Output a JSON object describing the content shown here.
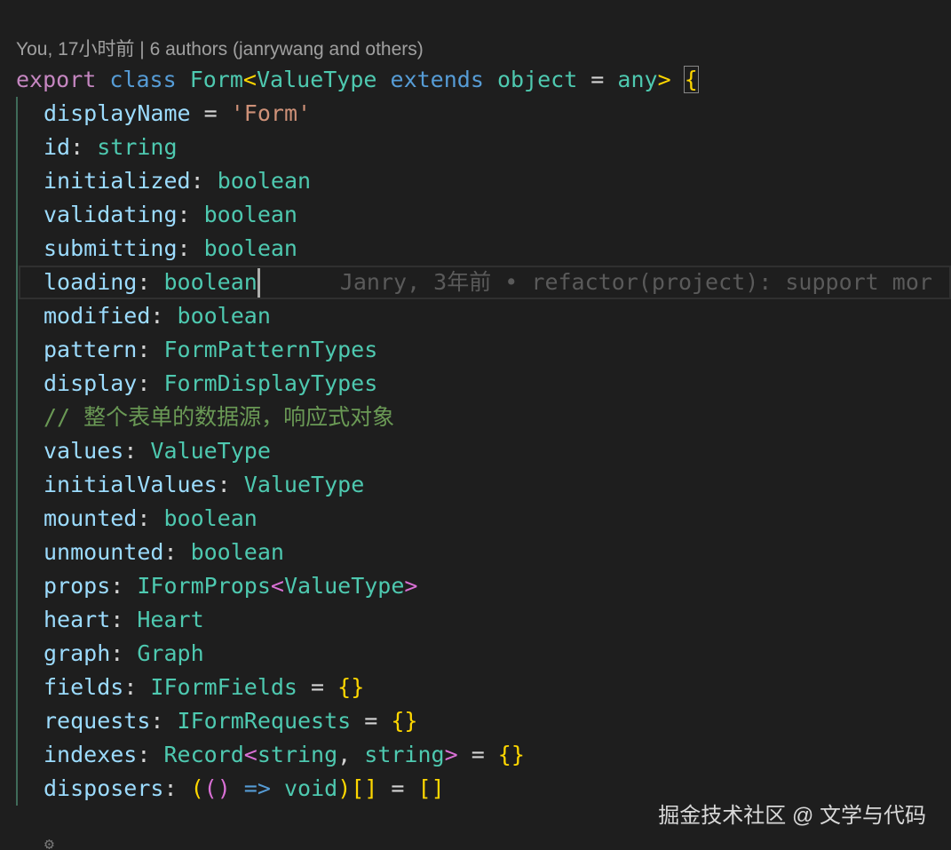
{
  "codelens": {
    "text": "You, 17小时前 | 6 authors (janrywang and others)"
  },
  "header": {
    "export": "export",
    "class": "class",
    "name": "Form",
    "lt": "<",
    "type_param": "ValueType",
    "extends": "extends",
    "constraint": "object",
    "eq": " = ",
    "default": "any",
    "gt": ">",
    "open_brace": "{"
  },
  "lines": {
    "displayName": {
      "name": "displayName",
      "op": " = ",
      "value": "'Form'"
    },
    "id": {
      "name": "id",
      "colon": ": ",
      "type": "string"
    },
    "initialized": {
      "name": "initialized",
      "colon": ": ",
      "type": "boolean"
    },
    "validating": {
      "name": "validating",
      "colon": ": ",
      "type": "boolean"
    },
    "submitting": {
      "name": "submitting",
      "colon": ": ",
      "type": "boolean"
    },
    "loading": {
      "name": "loading",
      "colon": ": ",
      "type": "boolean"
    },
    "modified": {
      "name": "modified",
      "colon": ": ",
      "type": "boolean"
    },
    "pattern": {
      "name": "pattern",
      "colon": ": ",
      "type": "FormPatternTypes"
    },
    "display": {
      "name": "display",
      "colon": ": ",
      "type": "FormDisplayTypes"
    },
    "comment": "// 整个表单的数据源，响应式对象",
    "values": {
      "name": "values",
      "colon": ": ",
      "type": "ValueType"
    },
    "initialValues": {
      "name": "initialValues",
      "colon": ": ",
      "type": "ValueType"
    },
    "mounted": {
      "name": "mounted",
      "colon": ": ",
      "type": "boolean"
    },
    "unmounted": {
      "name": "unmounted",
      "colon": ": ",
      "type": "boolean"
    },
    "props": {
      "name": "props",
      "colon": ": ",
      "type": "IFormProps",
      "lt": "<",
      "arg": "ValueType",
      "gt": ">"
    },
    "heart": {
      "name": "heart",
      "colon": ": ",
      "type": "Heart"
    },
    "graph": {
      "name": "graph",
      "colon": ": ",
      "type": "Graph"
    },
    "fields": {
      "name": "fields",
      "colon": ": ",
      "type": "IFormFields",
      "op": " = ",
      "init": "{}"
    },
    "requests": {
      "name": "requests",
      "colon": ": ",
      "type": "IFormRequests",
      "op": " = ",
      "init": "{}"
    },
    "indexes": {
      "name": "indexes",
      "colon": ": ",
      "type": "Record",
      "lt": "<",
      "arg1": "string",
      "sep": ", ",
      "arg2": "string",
      "gt": ">",
      "op": " = ",
      "init": "{}"
    },
    "disposers": {
      "name": "disposers",
      "colon": ": ",
      "p_open": "(",
      "args": "()",
      "arrow": " => ",
      "ret": "void",
      "p_close": ")",
      "arr": "[]",
      "op": " = ",
      "init": "[]"
    }
  },
  "blame": {
    "text": "Janry, 3年前 • refactor(project): support mor"
  },
  "watermark": {
    "text": "掘金技术社区 @ 文学与代码"
  },
  "colors": {
    "background": "#1e1e1e",
    "keyword": "#c586c0",
    "storage": "#569cd6",
    "type": "#4ec9b0",
    "property": "#9cdcfe",
    "string": "#ce9178",
    "comment": "#6a9955",
    "bracket1": "#ffd700",
    "bracket2": "#da70d6"
  },
  "icons": {
    "bottom": "settings-gear-icon"
  }
}
